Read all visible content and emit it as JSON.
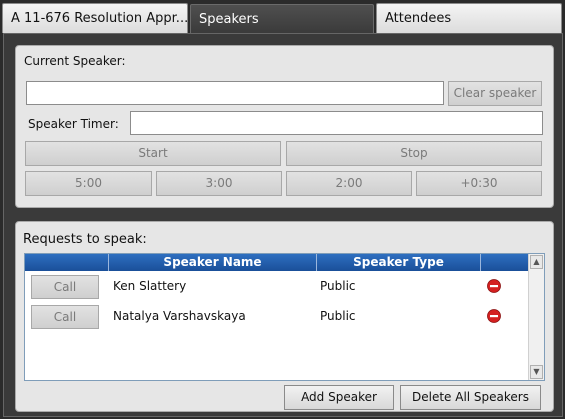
{
  "tabs": [
    {
      "label": "A 11-676 Resolution Appr..."
    },
    {
      "label": "Speakers"
    },
    {
      "label": "Attendees"
    }
  ],
  "speaker_panel": {
    "current_speaker_label": "Current Speaker:",
    "current_speaker_value": "",
    "clear_speaker_label": "Clear speaker",
    "timer_label": "Speaker Timer:",
    "timer_value": "",
    "start_label": "Start",
    "stop_label": "Stop",
    "presets": [
      "5:00",
      "3:00",
      "2:00",
      "+0:30"
    ]
  },
  "requests": {
    "title": "Requests to speak:",
    "columns": [
      "",
      "Speaker Name",
      "Speaker Type",
      ""
    ],
    "rows": [
      {
        "call_label": "Call",
        "name": "Ken Slattery",
        "type": "Public",
        "icon": "remove-icon"
      },
      {
        "call_label": "Call",
        "name": "Natalya Varshavskaya",
        "type": "Public",
        "icon": "remove-icon"
      }
    ],
    "add_label": "Add Speaker",
    "delete_all_label": "Delete All Speakers"
  },
  "colors": {
    "header_blue": "#1a4f99",
    "remove_red": "#d42020"
  }
}
